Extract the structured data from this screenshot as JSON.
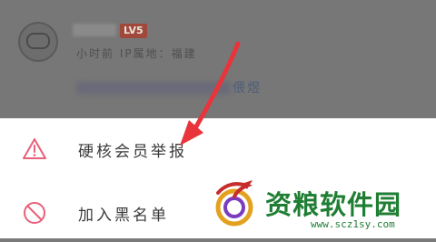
{
  "post": {
    "level_badge": "LV5",
    "meta_line": "小时前 IP属地：福建",
    "content_tail": "偎煜"
  },
  "menu": {
    "items": [
      {
        "label": "硬核会员举报",
        "icon": "warning-triangle-icon"
      },
      {
        "label": "加入黑名单",
        "icon": "block-circle-icon"
      }
    ]
  },
  "watermark": {
    "title": "资粮软件园",
    "url": "www.scz1sy.com"
  },
  "colors": {
    "accent_pink": "#e8607a",
    "watermark_green": "#1f7e33",
    "arrow_red": "#e8343a"
  }
}
